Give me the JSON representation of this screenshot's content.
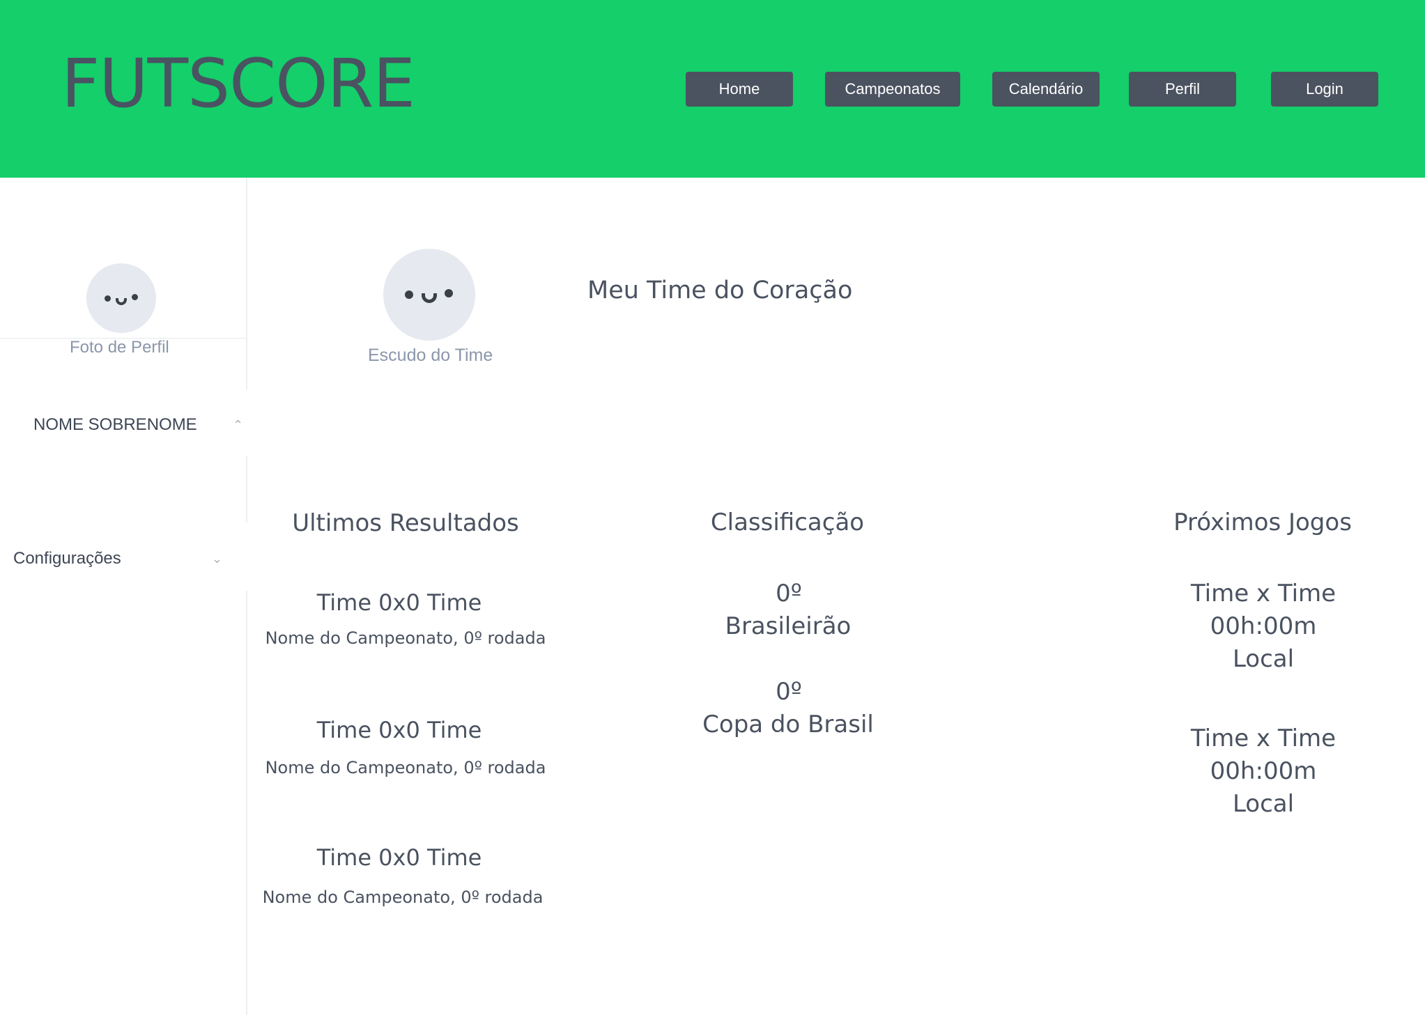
{
  "header": {
    "logo": "FUTSCORE",
    "nav": {
      "home": "Home",
      "campeonatos": "Campeonatos",
      "calendario": "Calendário",
      "perfil": "Perfil",
      "login": "Login"
    },
    "background_color": "#14cf6a",
    "button_color": "#4b5360"
  },
  "sidebar": {
    "photo_label": "Foto de Perfil",
    "name": "NOME SOBRENOME",
    "settings": "Configurações"
  },
  "team": {
    "crest_label": "Escudo do Time",
    "title": "Meu Time do Coração"
  },
  "results": {
    "title": "Ultimos Resultados",
    "items": [
      {
        "score": "Time 0x0 Time",
        "championship": "Nome do Campeonato, 0º rodada"
      },
      {
        "score": "Time 0x0 Time",
        "championship": "Nome do Campeonato, 0º rodada"
      },
      {
        "score": "Time 0x0 Time",
        "championship": "Nome do Campeonato, 0º rodada"
      }
    ]
  },
  "standings": {
    "title": "Classificação",
    "items": [
      {
        "position": "0º",
        "championship": "Brasileirão"
      },
      {
        "position": "0º",
        "championship": "Copa do Brasil"
      }
    ]
  },
  "upcoming": {
    "title": "Próximos Jogos",
    "items": [
      {
        "match": "Time x Time",
        "time": "00h:00m",
        "place": "Local"
      },
      {
        "match": "Time x Time",
        "time": "00h:00m",
        "place": "Local"
      }
    ]
  }
}
